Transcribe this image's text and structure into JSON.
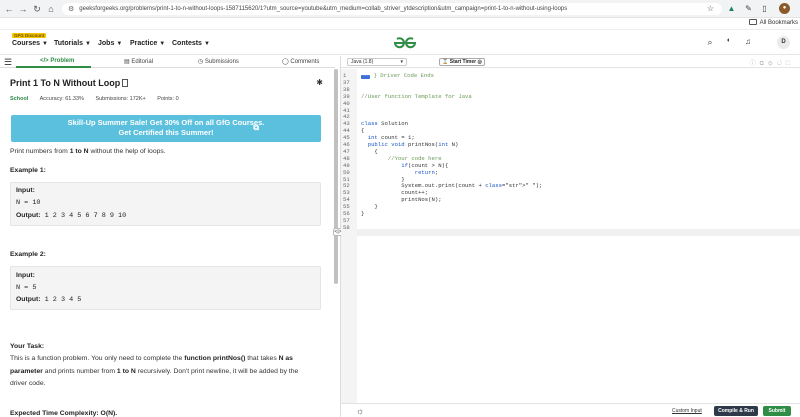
{
  "browser": {
    "url": "geeksforgeeks.org/problems/print-1-to-n-without-loops-1587115620/1?utm_source=youtube&utm_medium=collab_striver_ytdescription&utm_campaign=print-1-to-n-without-using-loops",
    "all_bookmarks": "All Bookmarks"
  },
  "header": {
    "badge": "GFG Discount",
    "menu": [
      "Courses",
      "Tutorials",
      "Jobs",
      "Practice",
      "Contests"
    ],
    "user_initial": "D"
  },
  "tabs": [
    "Problem",
    "Editorial",
    "Submissions",
    "Comments"
  ],
  "problem": {
    "title": "Print 1 To N Without Loop",
    "difficulty": "School",
    "accuracy": "Accuracy: 61.33%",
    "submissions": "Submissions: 172K+",
    "points": "Points: 0",
    "banner_line1": "Skill-Up Summer Sale! Get 30% Off on all GfG Courses.",
    "banner_line2": "Get Certified this Summer!",
    "desc_pre": "Print numbers from ",
    "desc_b1": "1 to N",
    "desc_post": " without the help of loops.",
    "ex1_title": "Example 1:",
    "ex1_input_label": "Input:",
    "ex1_input": "N = 10",
    "ex1_output_label": "Output:",
    "ex1_output": " 1 2 3 4 5 6 7 8 9 10",
    "ex2_title": "Example 2:",
    "ex2_input_label": "Input:",
    "ex2_input": "N = 5",
    "ex2_output_label": "Output:",
    "ex2_output": " 1 2 3 4 5",
    "task_title": "Your Task:",
    "task_l1_pre": "This is a function problem. You only need to complete the ",
    "task_l1_b": "function printNos()",
    "task_l1_post": " that takes ",
    "task_l1_b2": "N as",
    "task_l2_b": "parameter",
    "task_l2_mid": " and prints number from ",
    "task_l2_b2": "1 to N",
    "task_l2_post": " recursively. Don't print newline, it will be added by the",
    "task_l3": "driver code.",
    "complexity": "Expected Time Complexity: O(N)."
  },
  "editor": {
    "language": "Java (1.8)",
    "timer": "Start Timer",
    "lines": [
      {
        "n": "1",
        "fold": true,
        "text": "} Driver Code Ends"
      },
      {
        "n": "37",
        "text": ""
      },
      {
        "n": "38",
        "text": ""
      },
      {
        "n": "39",
        "text": "//User function Template for Java"
      },
      {
        "n": "40",
        "text": ""
      },
      {
        "n": "41",
        "text": ""
      },
      {
        "n": "42",
        "text": ""
      },
      {
        "n": "43",
        "text": "class Solution"
      },
      {
        "n": "44",
        "text": "{"
      },
      {
        "n": "45",
        "text": "  int count = 1;"
      },
      {
        "n": "46",
        "text": "  public void printNos(int N)"
      },
      {
        "n": "47",
        "text": "    {"
      },
      {
        "n": "48",
        "text": "        //Your code here"
      },
      {
        "n": "49",
        "text": "            if(count > N){"
      },
      {
        "n": "50",
        "text": "                return;"
      },
      {
        "n": "51",
        "text": "            }"
      },
      {
        "n": "52",
        "text": "            System.out.print(count + \" \");"
      },
      {
        "n": "53",
        "text": "            count++;"
      },
      {
        "n": "54",
        "text": "            printNos(N);"
      },
      {
        "n": "55",
        "text": "    }"
      },
      {
        "n": "56",
        "text": "}"
      },
      {
        "n": "57",
        "text": ""
      },
      {
        "n": "58",
        "text": ""
      }
    ]
  },
  "footer": {
    "custom_input": "Custom Input",
    "compile": "Compile & Run",
    "submit": "Submit"
  }
}
